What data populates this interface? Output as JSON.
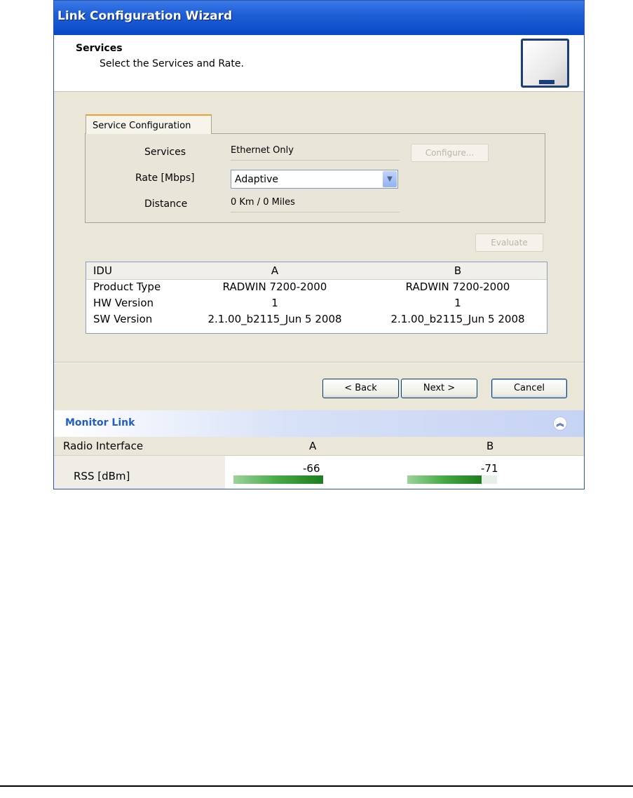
{
  "window": {
    "title": "Link Configuration Wizard"
  },
  "header": {
    "title": "Services",
    "subtitle": "Select the Services and Rate."
  },
  "service_tab": {
    "label": "Service Configuration",
    "services_label": "Services",
    "services_value": "Ethernet Only",
    "configure_button": "Configure...",
    "rate_label": "Rate [Mbps]",
    "rate_value": "Adaptive",
    "distance_label": "Distance",
    "distance_value": "0 Km / 0 Miles"
  },
  "evaluate_button": "Evaluate",
  "info_table": {
    "headers": [
      "IDU",
      "A",
      "B"
    ],
    "rows": [
      [
        "Product Type",
        "RADWIN 7200-2000",
        "RADWIN 7200-2000"
      ],
      [
        "HW Version",
        "1",
        "1"
      ],
      [
        "SW Version",
        "2.1.00_b2115_Jun  5 2008",
        "2.1.00_b2115_Jun  5 2008"
      ]
    ]
  },
  "buttons": {
    "back": "< Back",
    "next": "Next >",
    "cancel": "Cancel"
  },
  "monitor": {
    "title": "Monitor Link",
    "headers": [
      "Radio Interface",
      "A",
      "B"
    ],
    "row_label": "RSS [dBm]",
    "a_value": "-66",
    "b_value": "-71",
    "a_level": 1.0,
    "b_level": 0.83,
    "bar_color": "#45a845"
  },
  "colors": {
    "titlebar": "#0a49c7",
    "accent_tab": "#f0a030",
    "monitor_title": "#215dc6"
  }
}
